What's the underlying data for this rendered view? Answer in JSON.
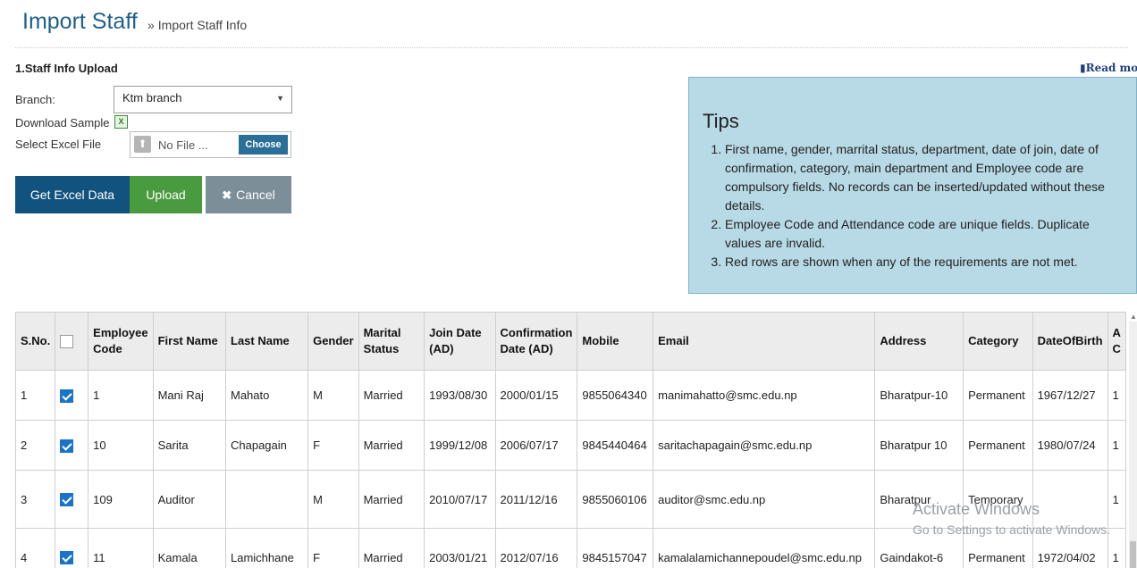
{
  "header": {
    "title": "Import Staff",
    "breadcrumb_sep": "»",
    "breadcrumb": "Import Staff Info"
  },
  "upload_section": {
    "heading": "1.Staff Info Upload",
    "branch_label": "Branch:",
    "branch_value": "Ktm branch",
    "download_sample_label": "Download Sample",
    "select_file_label": "Select Excel File",
    "file_placeholder": "No File ...",
    "choose_label": "Choose"
  },
  "buttons": {
    "get_excel": "Get Excel Data",
    "upload": "Upload",
    "cancel": "Cancel"
  },
  "read_more": "Read mor",
  "tips": {
    "title": "Tips",
    "items": [
      "First name, gender, marrital status, department, date of join, date of confirmation, category, main department and Employee code are compulsory fields. No records can be inserted/updated without these details.",
      "Employee Code and Attendance code are unique fields. Duplicate values are invalid.",
      "Red rows are shown when any of the requirements are not met."
    ]
  },
  "table": {
    "headers": [
      "S.No.",
      "",
      "Employee Code",
      "First Name",
      "Last Name",
      "Gender",
      "Marital Status",
      "Join Date (AD)",
      "Confirmation Date (AD)",
      "Mobile",
      "Email",
      "Address",
      "Category",
      "DateOfBirth",
      "A C"
    ],
    "rows": [
      {
        "sno": "1",
        "checked": true,
        "code": "1",
        "first": "Mani Raj",
        "last": "Mahato",
        "gender": "M",
        "marital": "Married",
        "join": "1993/08/30",
        "confirm": "2000/01/15",
        "mobile": "9855064340",
        "email": "manimahatto@smc.edu.np",
        "address": "Bharatpur-10",
        "category": "Permanent",
        "dob": "1967/12/27",
        "extra": "1"
      },
      {
        "sno": "2",
        "checked": true,
        "code": "10",
        "first": "Sarita",
        "last": "Chapagain",
        "gender": "F",
        "marital": "Married",
        "join": "1999/12/08",
        "confirm": "2006/07/17",
        "mobile": "9845440464",
        "email": "saritachapagain@smc.edu.np",
        "address": "Bharatpur 10",
        "category": "Permanent",
        "dob": "1980/07/24",
        "extra": "1"
      },
      {
        "sno": "3",
        "checked": true,
        "code": "109",
        "first": "Auditor",
        "last": "",
        "gender": "M",
        "marital": "Married",
        "join": "2010/07/17",
        "confirm": "2011/12/16",
        "mobile": "9855060106",
        "email": "auditor@smc.edu.np",
        "address": "Bharatpur",
        "category": "Temporary",
        "dob": "",
        "extra": "1"
      },
      {
        "sno": "4",
        "checked": true,
        "code": "11",
        "first": "Kamala",
        "last": "Lamichhane",
        "gender": "F",
        "marital": "Married",
        "join": "2003/01/21",
        "confirm": "2012/07/16",
        "mobile": "9845157047",
        "email": "kamalalamichannepoudel@smc.edu.np",
        "address": "Gaindakot-6",
        "category": "Permanent",
        "dob": "1972/04/02",
        "extra": "1"
      }
    ]
  },
  "watermark": {
    "line1": "Activate Windows",
    "line2": "Go to Settings to activate Windows."
  }
}
